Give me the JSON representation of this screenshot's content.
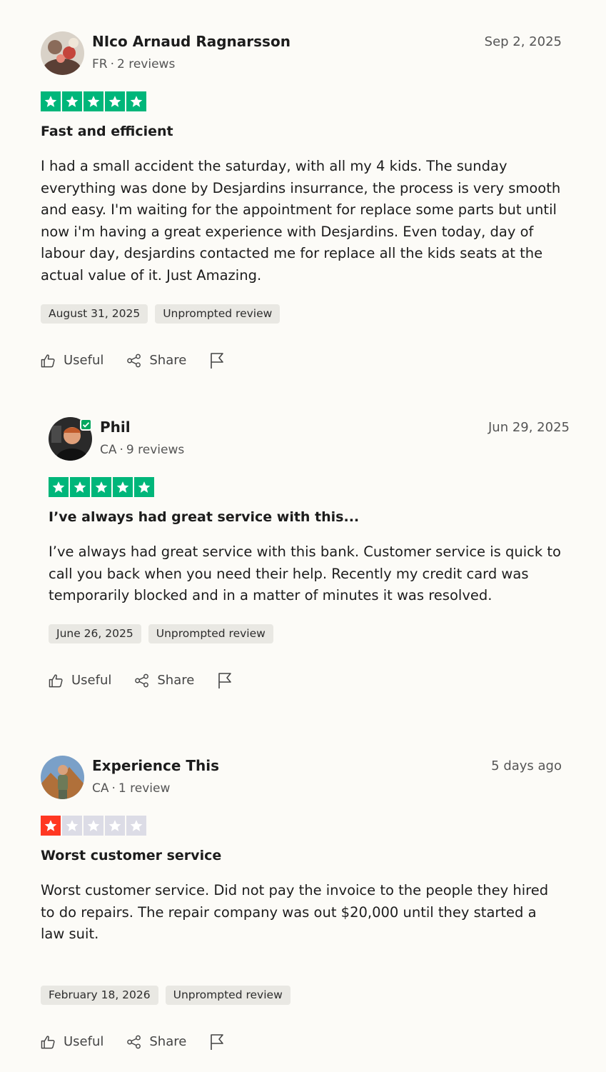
{
  "reviews": [
    {
      "name": "NIco Arnaud Ragnarsson",
      "country": "FR",
      "review_count": "2 reviews",
      "date": "Sep 2, 2025",
      "rating": 5,
      "title": "Fast and efficient",
      "body": "I had a small accident the saturday, with all my 4 kids. The sunday everything was done by Desjardins insurrance, the process is very smooth and easy. I'm waiting for the appointment for replace some parts but until now i'm having a great experience with Desjardins. Even today, day of labour day, desjardins contacted me for replace all the kids seats at the actual value of it. Just Amazing.",
      "experience_date": "August 31, 2025",
      "tag": "Unprompted review",
      "useful_label": "Useful",
      "share_label": "Share"
    },
    {
      "name": "Phil",
      "country": "CA",
      "review_count": "9 reviews",
      "date": "Jun 29, 2025",
      "rating": 5,
      "title": "I’ve always had great service with this...",
      "body": "I’ve always had great service with this bank. Customer service is quick to call you back when you need their help. Recently my credit card was temporarily blocked and in a matter of minutes it was resolved.",
      "experience_date": "June 26, 2025",
      "tag": "Unprompted review",
      "useful_label": "Useful",
      "share_label": "Share"
    },
    {
      "name": "Experience This",
      "country": "CA",
      "review_count": "1 review",
      "date": "5 days ago",
      "rating": 1,
      "title": "Worst customer service",
      "body": "Worst customer service. Did not pay the invoice to the people they hired to do repairs. The repair company was out $20,000 until they started a law suit.",
      "experience_date": "February 18, 2026",
      "tag": "Unprompted review",
      "useful_label": "Useful",
      "share_label": "Share"
    }
  ],
  "colors": {
    "star_green": "#00b67a",
    "star_red": "#ff3722",
    "star_empty": "#dcdce6",
    "verified": "#04a65f"
  }
}
